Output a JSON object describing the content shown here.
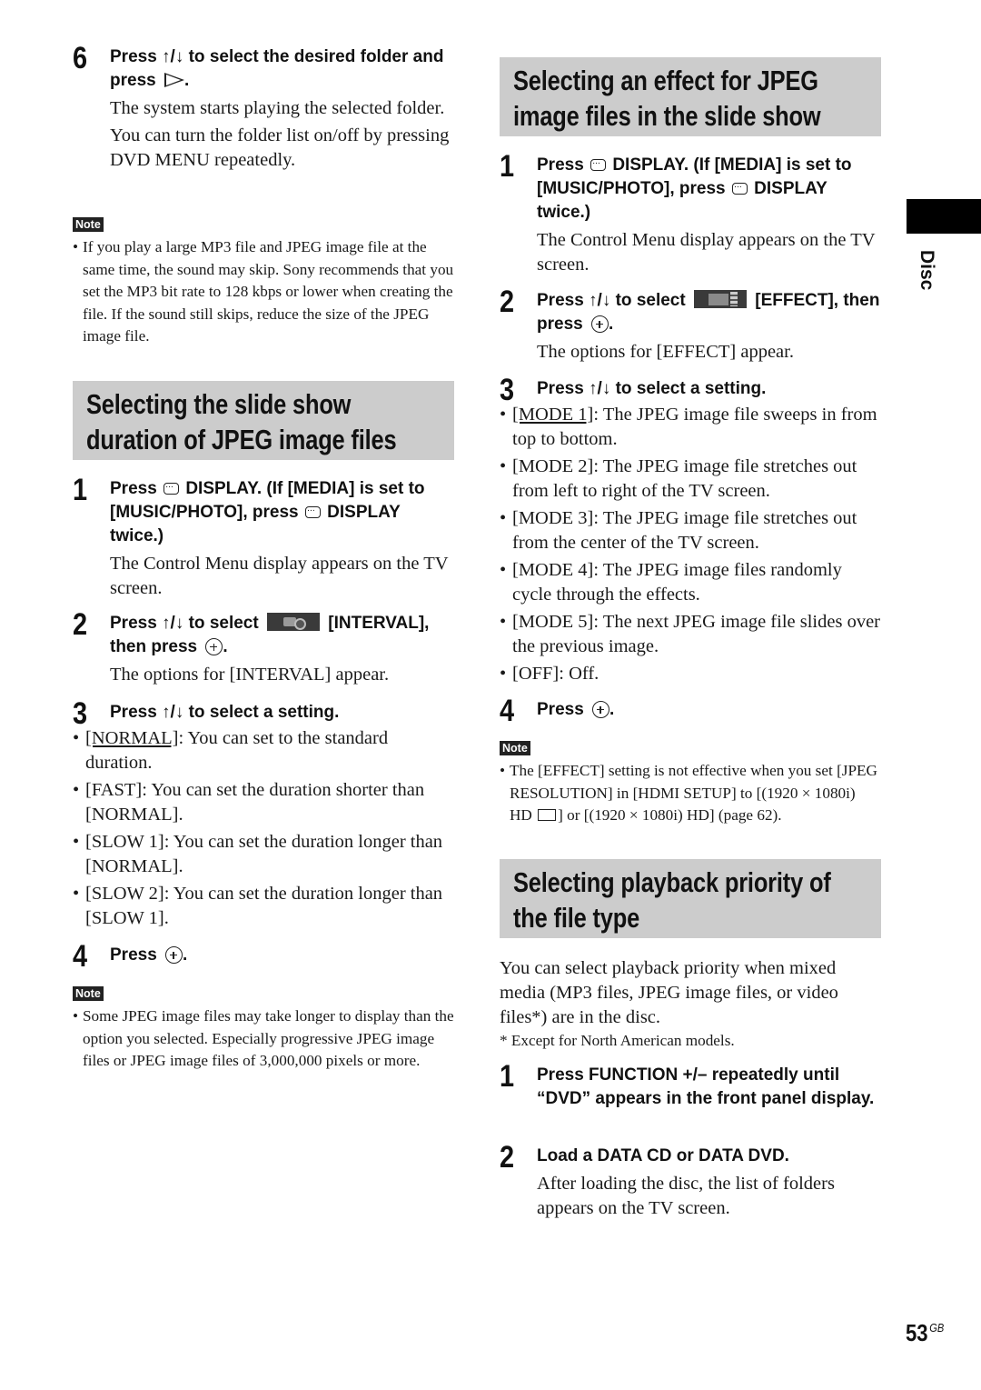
{
  "left": {
    "step6": {
      "number": "6",
      "title_pre": "Press ",
      "arrows": "↑/↓",
      "title_post": " to select the desired folder and press ",
      "title_end": ".",
      "body": [
        "The system starts playing the selected folder.",
        "You can turn the folder list on/off by pressing DVD MENU repeatedly."
      ]
    },
    "note1": {
      "badge": "Note",
      "text": "If you play a large MP3 file and JPEG image file at the same time, the sound may skip. Sony recommends that you set the MP3 bit rate to 128 kbps or lower when creating the file. If the sound still skips, reduce the size of the JPEG image file."
    },
    "section": {
      "heading": "Selecting the slide show duration of JPEG image files",
      "step1": {
        "number": "1",
        "a": "Press ",
        "b": " DISPLAY. (If [MEDIA] is set to [MUSIC/PHOTO], press ",
        "c": " DISPLAY twice.)",
        "body": "The Control Menu display appears on the TV screen."
      },
      "step2": {
        "number": "2",
        "a": "Press ",
        "arrows": "↑/↓",
        "b": " to select ",
        "c": " [INTERVAL], then press ",
        "d": ".",
        "body": "The options for [INTERVAL] appear."
      },
      "step3": {
        "number": "3",
        "a": "Press ",
        "arrows": "↑/↓",
        "b": " to select a setting.",
        "options": [
          {
            "label": "[NORMAL]",
            "text": ": You can set to the standard duration.",
            "default": true
          },
          {
            "label": "[FAST]",
            "text": ": You can set the duration shorter than [NORMAL].",
            "default": false
          },
          {
            "label": "[SLOW 1]",
            "text": ": You can set the duration longer than [NORMAL].",
            "default": false
          },
          {
            "label": "[SLOW 2]",
            "text": ": You can set the duration longer than [SLOW 1].",
            "default": false
          }
        ]
      },
      "step4": {
        "number": "4",
        "a": "Press ",
        "b": "."
      },
      "note": {
        "badge": "Note",
        "text": "Some JPEG image files may take longer to display than the option you selected. Especially progressive JPEG image files or JPEG image files of 3,000,000 pixels or more."
      }
    }
  },
  "right": {
    "section1": {
      "heading": "Selecting an effect for JPEG image files in the slide show",
      "step1": {
        "number": "1",
        "a": "Press ",
        "b": " DISPLAY. (If [MEDIA] is set to [MUSIC/PHOTO], press ",
        "c": " DISPLAY twice.)",
        "body": "The Control Menu display appears on the TV screen."
      },
      "step2": {
        "number": "2",
        "a": "Press ",
        "arrows": "↑/↓",
        "b": " to select ",
        "c": " [EFFECT], then press ",
        "d": ".",
        "body": "The options for [EFFECT] appear."
      },
      "step3": {
        "number": "3",
        "a": "Press ",
        "arrows": "↑/↓",
        "b": " to select a setting.",
        "options": [
          {
            "label": "[MODE 1]",
            "text": ": The JPEG image file sweeps in from top to bottom.",
            "default": true
          },
          {
            "label": "[MODE 2]",
            "text": ": The JPEG image file stretches out from left to right of the TV screen.",
            "default": false
          },
          {
            "label": "[MODE 3]",
            "text": ": The JPEG image file stretches out from the center of the TV screen.",
            "default": false
          },
          {
            "label": "[MODE 4]",
            "text": ": The JPEG image files randomly cycle through the effects.",
            "default": false
          },
          {
            "label": "[MODE 5]",
            "text": ": The next JPEG image file slides over the previous image.",
            "default": false
          },
          {
            "label": "[OFF]",
            "text": ": Off.",
            "default": false
          }
        ]
      },
      "step4": {
        "number": "4",
        "a": "Press ",
        "b": "."
      },
      "note": {
        "badge": "Note",
        "a": "The [EFFECT] setting is not effective when you set [JPEG RESOLUTION] in [HDMI SETUP] to [(1920 × 1080i) HD ",
        "b": "] or [(1920 × 1080i) HD] (page 62)."
      }
    },
    "section2": {
      "heading": "Selecting playback priority of the file type",
      "intro": "You can select playback priority when mixed media (MP3 files, JPEG image files, or video files*) are in the disc.",
      "footnote": "*  Except for North American models.",
      "step1": {
        "number": "1",
        "title": "Press FUNCTION +/– repeatedly until “DVD” appears in the front panel display."
      },
      "step2": {
        "number": "2",
        "title": "Load a DATA CD or DATA DVD.",
        "body": "After loading the disc, the list of folders appears on the TV screen."
      }
    }
  },
  "side_tab": {
    "label": "Disc"
  },
  "page": {
    "number": "53",
    "suffix": "GB"
  }
}
